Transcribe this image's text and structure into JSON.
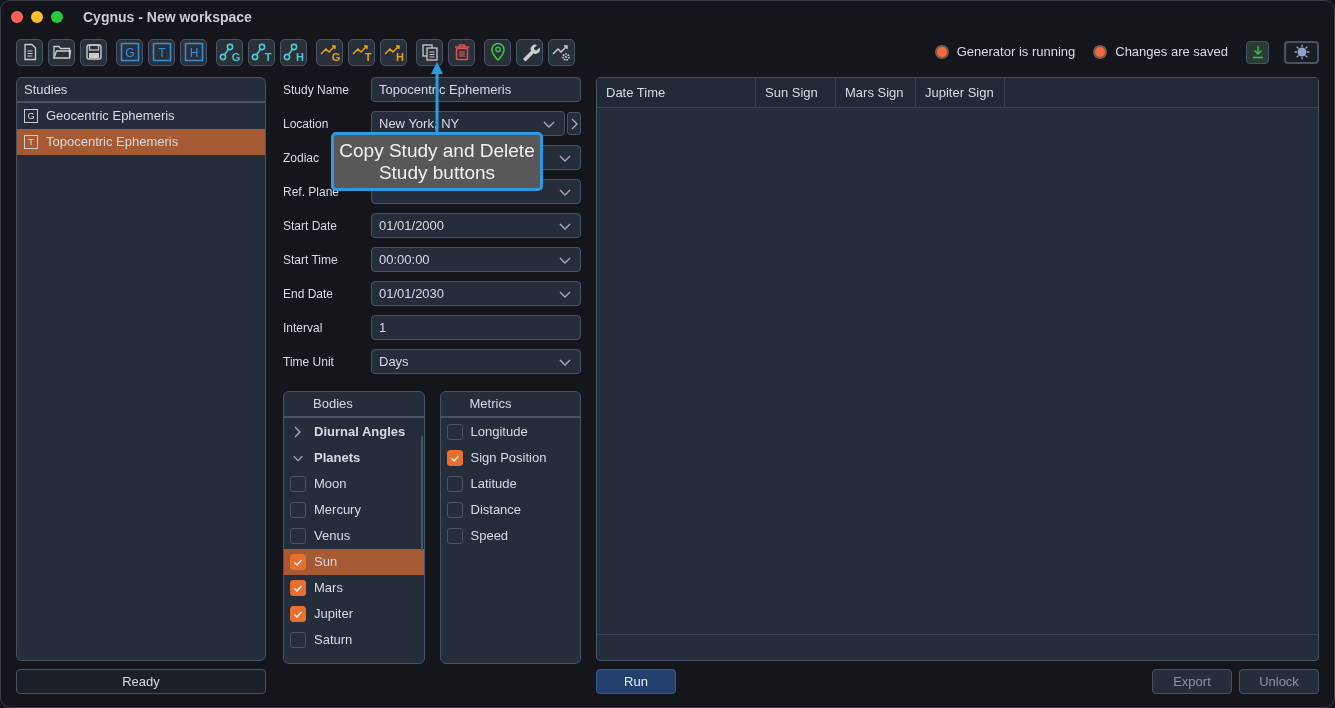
{
  "window": {
    "title": "Cygnus - New workspace"
  },
  "toolbar": [
    [
      {
        "kind": "document"
      },
      {
        "kind": "folder"
      },
      {
        "kind": "save"
      }
    ],
    [
      {
        "kind": "boxed",
        "letter": "G"
      },
      {
        "kind": "boxed",
        "letter": "T"
      },
      {
        "kind": "boxed",
        "letter": "H"
      }
    ],
    [
      {
        "kind": "nodes",
        "letter": "G"
      },
      {
        "kind": "nodes",
        "letter": "T"
      },
      {
        "kind": "nodes",
        "letter": "H"
      }
    ],
    [
      {
        "kind": "trend",
        "letter": "G"
      },
      {
        "kind": "trend",
        "letter": "T"
      },
      {
        "kind": "trend",
        "letter": "H"
      }
    ],
    [
      {
        "kind": "copy"
      },
      {
        "kind": "delete"
      }
    ],
    [
      {
        "kind": "pin"
      },
      {
        "kind": "wrench"
      },
      {
        "kind": "trend-gear"
      }
    ]
  ],
  "indicators": [
    {
      "label": "Generator is running",
      "color": "#f26a3d"
    },
    {
      "label": "Changes are saved",
      "color": "#f26a3d"
    }
  ],
  "studies": {
    "title": "Studies",
    "items": [
      {
        "letter": "G",
        "label": "Geocentric Ephemeris",
        "selected": false
      },
      {
        "letter": "T",
        "label": "Topocentric Ephemeris",
        "selected": true
      }
    ]
  },
  "status": "Ready",
  "form": [
    {
      "label": "Study Name",
      "kind": "text",
      "value": "Topocentric Ephemeris"
    },
    {
      "label": "Location",
      "kind": "location",
      "value": "New York, NY"
    },
    {
      "label": "Zodiac",
      "kind": "select"
    },
    {
      "label": "Ref. Plane",
      "kind": "select"
    },
    {
      "label": "Start Date",
      "kind": "select",
      "value": "01/01/2000"
    },
    {
      "label": "Start Time",
      "kind": "select",
      "value": "00:00:00"
    },
    {
      "label": "End Date",
      "kind": "select",
      "value": "01/01/2030"
    },
    {
      "label": "Interval",
      "kind": "text",
      "value": "1"
    },
    {
      "label": "Time Unit",
      "kind": "select",
      "value": "Days"
    }
  ],
  "bodies": {
    "title": "Bodies",
    "items": [
      {
        "label": "Diurnal Angles",
        "expanded": false
      },
      {
        "label": "Planets",
        "expanded": true,
        "children": [
          {
            "label": "Moon",
            "checked": false,
            "selected": false
          },
          {
            "label": "Mercury",
            "checked": false,
            "selected": false
          },
          {
            "label": "Venus",
            "checked": false,
            "selected": false
          },
          {
            "label": "Sun",
            "checked": true,
            "selected": true
          },
          {
            "label": "Mars",
            "checked": true,
            "selected": false
          },
          {
            "label": "Jupiter",
            "checked": true,
            "selected": false
          },
          {
            "label": "Saturn",
            "checked": false,
            "selected": false
          }
        ]
      }
    ]
  },
  "metrics": {
    "title": "Metrics",
    "items": [
      {
        "label": "Longitude",
        "checked": false
      },
      {
        "label": "Sign Position",
        "checked": true
      },
      {
        "label": "Latitude",
        "checked": false
      },
      {
        "label": "Distance",
        "checked": false
      },
      {
        "label": "Speed",
        "checked": false
      }
    ]
  },
  "table": {
    "columns": [
      "Date Time",
      "Sun Sign",
      "Mars Sign",
      "Jupiter Sign"
    ]
  },
  "buttons": {
    "run": "Run",
    "export": "Export",
    "unlock": "Unlock"
  },
  "callout": "Copy Study and Delete Study buttons"
}
